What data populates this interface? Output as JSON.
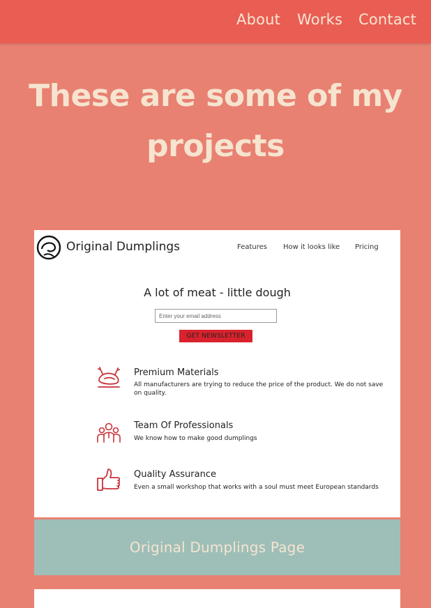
{
  "nav": {
    "items": [
      {
        "label": "About"
      },
      {
        "label": "Works"
      },
      {
        "label": "Contact"
      }
    ]
  },
  "hero": {
    "title": "These are some of my projects"
  },
  "project": {
    "screenshot": {
      "brand": "Original Dumplings",
      "nav": [
        "Features",
        "How it looks like",
        "Pricing"
      ],
      "headline": "A lot of meat - little dough",
      "email_placeholder": "Enter your email address",
      "button_label": "GET NEWSLETTER",
      "features": [
        {
          "title": "Premium Materials",
          "desc": "All manufacturers are trying to reduce the price of the product. We do not save on quality.",
          "icon": "chicken-icon"
        },
        {
          "title": "Team Of Professionals",
          "desc": "We know how to make good dumplings",
          "icon": "team-icon"
        },
        {
          "title": "Quality Assurance",
          "desc": "Even a small workshop that works with a soul must meet European standards",
          "icon": "thumbs-up-icon"
        }
      ],
      "accent_color": "#d8222d"
    },
    "caption": "Original Dumplings Page"
  },
  "colors": {
    "background": "#e88172",
    "navbar": "#ea5d53",
    "text_light": "#f6e4cf",
    "caption_bg": "#9ebfb8"
  }
}
